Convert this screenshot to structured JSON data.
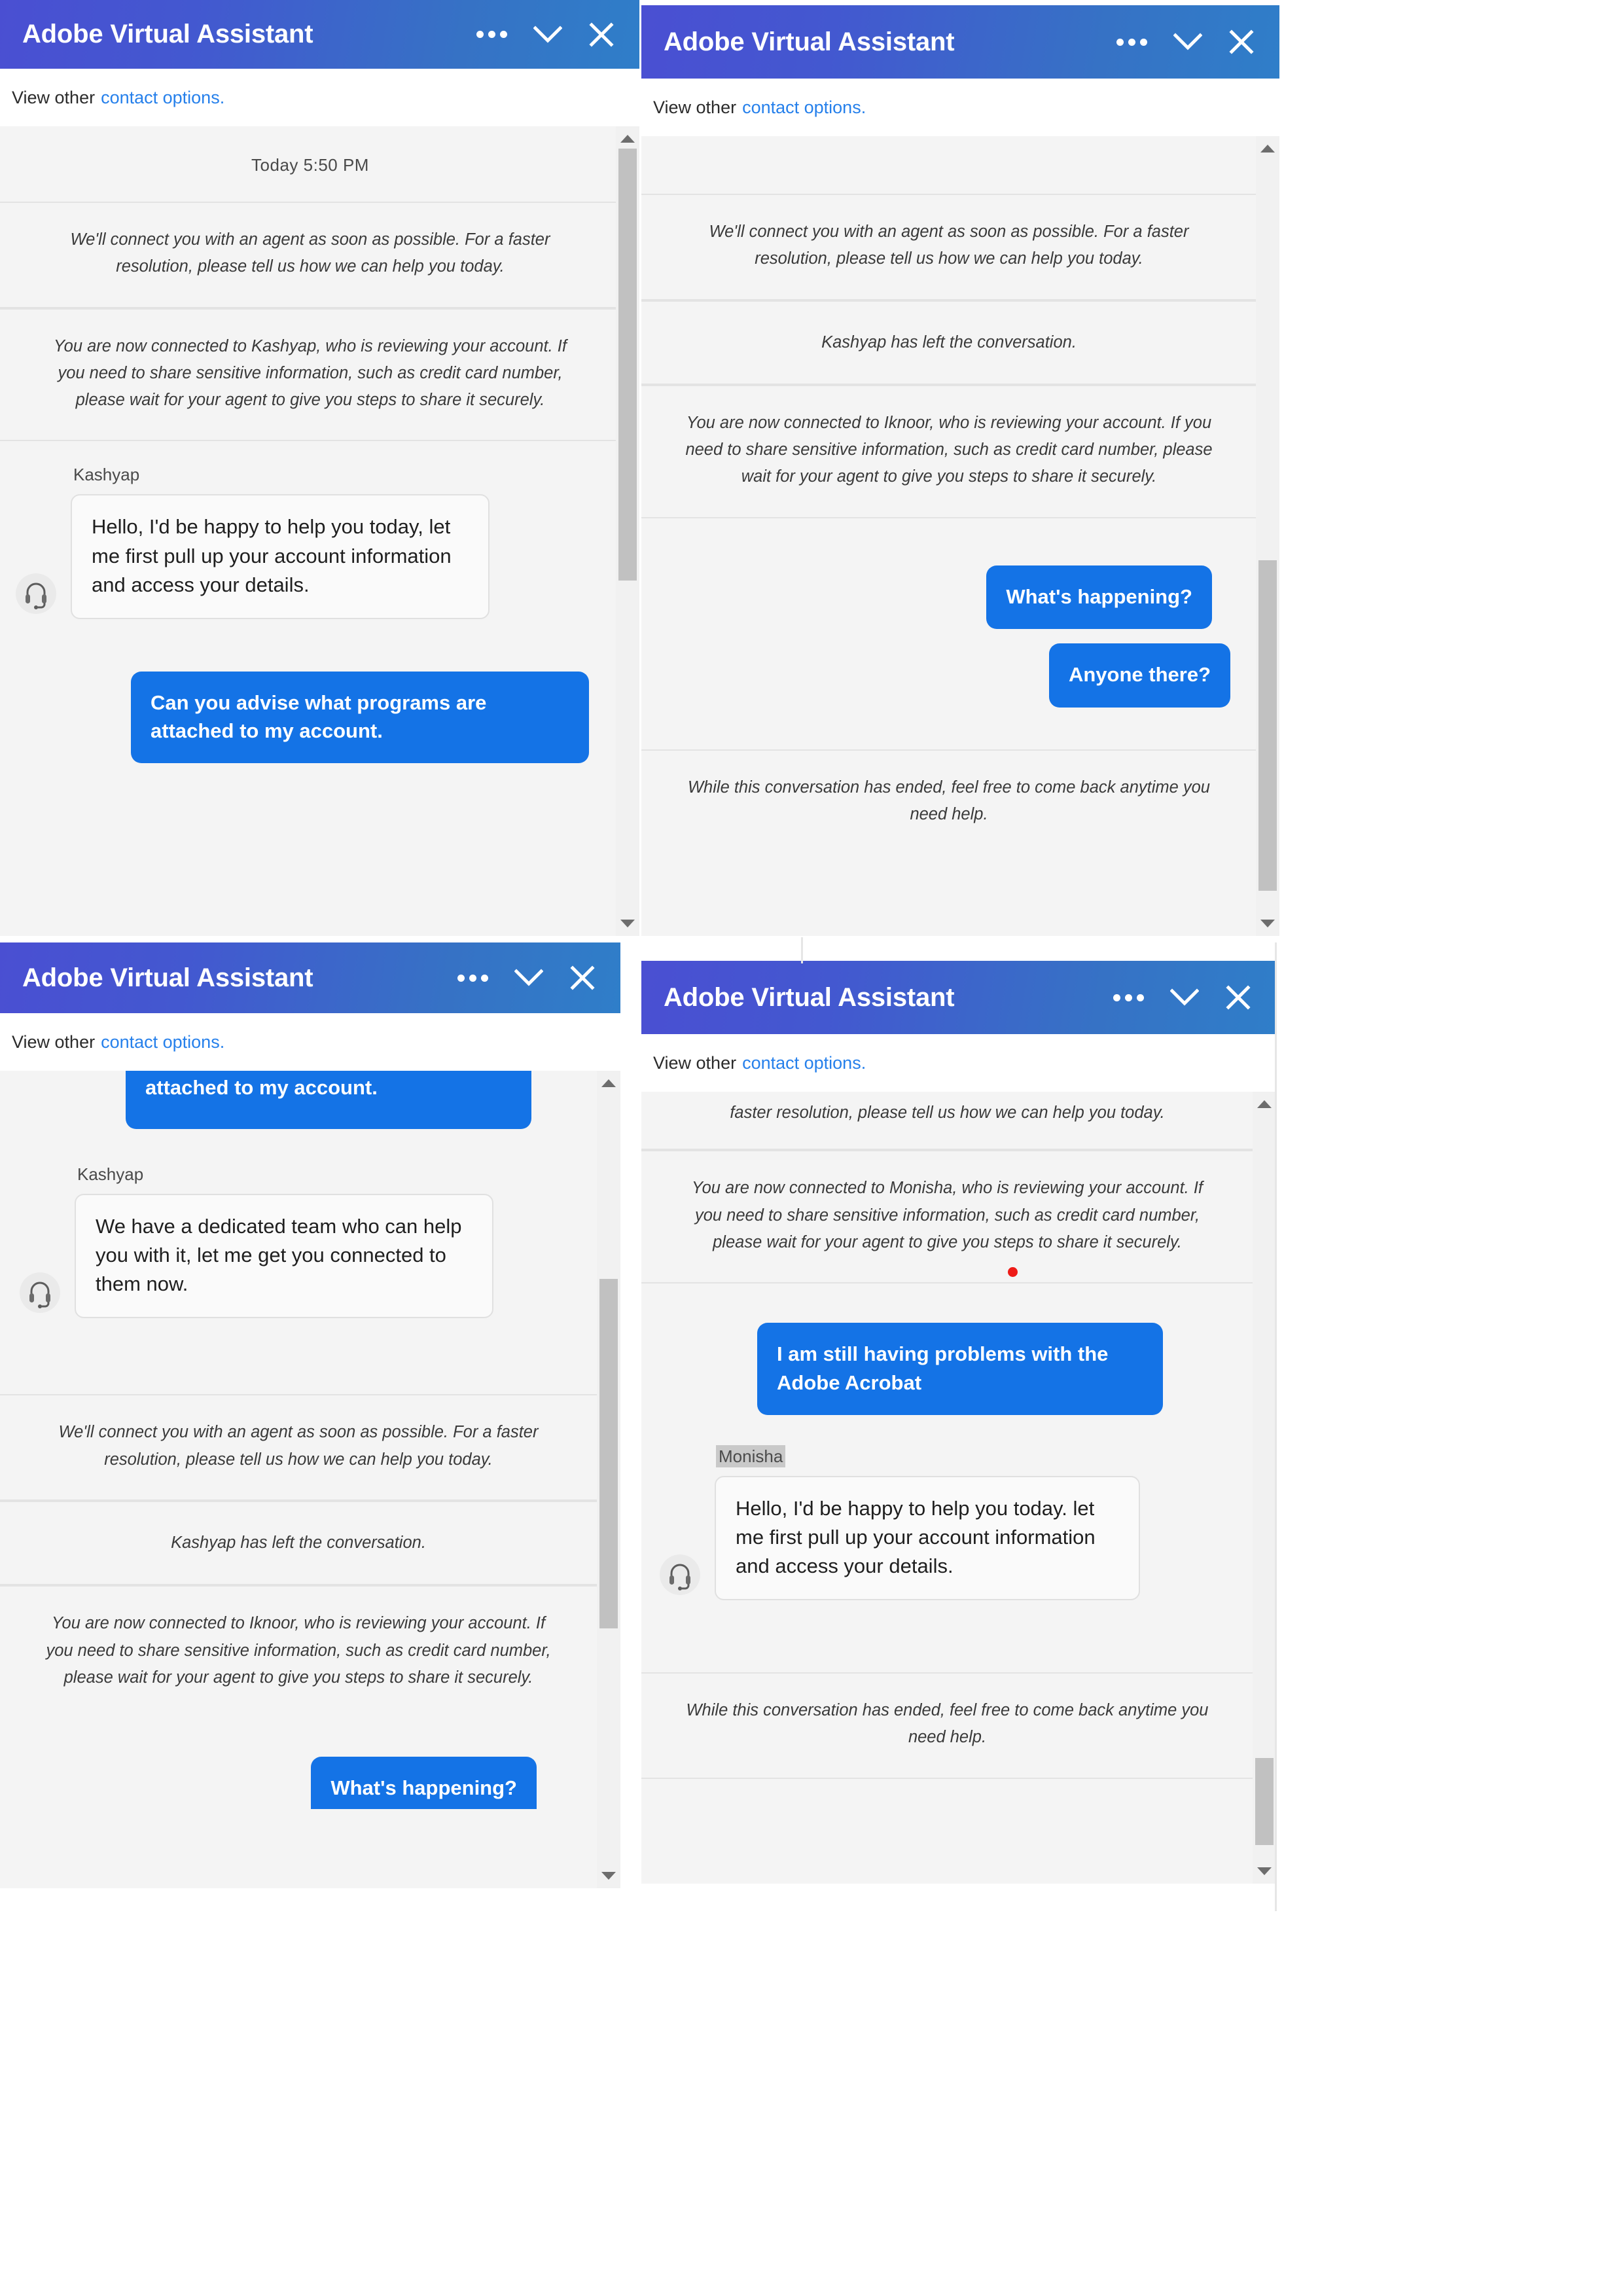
{
  "window_title": "Adobe Virtual Assistant",
  "subbar": {
    "prefix": "View other",
    "link": "contact options."
  },
  "icons": {
    "more": "more-options-icon",
    "minimize": "chevron-down-icon",
    "close": "close-icon",
    "avatar": "headset-agent-avatar-icon",
    "scroll_up": "scroll-up-arrow-icon",
    "scroll_down": "scroll-down-arrow-icon"
  },
  "colors": {
    "header_gradient_start": "#4a4fd2",
    "header_gradient_end": "#2f7ec9",
    "user_bubble": "#1473e6",
    "link": "#2680eb",
    "transcript_bg": "#f4f4f4",
    "cursor_dot": "#ee1b17"
  },
  "strings": {
    "connect_agent": "We'll connect you with an agent as soon as possible. For a faster resolution, please tell us how we can help you today.",
    "connected_kashyap": "You are now connected to Kashyap, who is reviewing your account. If you need to share sensitive information, such as credit card number, please wait for your agent to give you steps to share it securely.",
    "connected_iknoor": "You are now connected to Iknoor, who is reviewing your account. If you need to share sensitive information, such as credit card number, please wait for your agent to give you steps to share it securely.",
    "connected_monisha": "You are now connected to Monisha, who is reviewing your account. If you need to share sensitive information, such as credit card number, please wait for your agent to give you steps to share it securely.",
    "kashyap_left": "Kashyap has left the conversation.",
    "conversation_ended": "While this conversation has ended, feel free to come back anytime you need help.",
    "faster_resolution_tail": "faster resolution, please tell us how we can help you today.",
    "timestamp": "Today  5:50 PM",
    "agent_kashyap": "Kashyap",
    "agent_monisha": "Monisha",
    "greet": "Hello, I'd be happy to help you today, let me first pull up your account information and access your details.",
    "greet_monisha": "Hello, I'd be happy to help you today. let me first pull up your account information and access your details.",
    "user_programs": "Can you advise what programs are attached to my account.",
    "user_programs_tail": "attached to my account.",
    "agent_dedicated": "We have a dedicated team who can help you with it, let me get you connected to them now.",
    "user_whats_happening": "What's happening?",
    "user_anyone_there": "Anyone there?",
    "user_acrobat": "I am still having problems with the Adobe Acrobat"
  },
  "panels": [
    {
      "id": "panel-top-left",
      "title": "Adobe Virtual Assistant",
      "messages": [
        {
          "kind": "daystamp",
          "text": "Today  5:50 PM"
        },
        {
          "kind": "system",
          "text": "We'll connect you with an agent as soon as possible. For a faster resolution, please tell us how we can help you today."
        },
        {
          "kind": "system",
          "text": "You are now connected to Kashyap, who is reviewing your account. If you need to share sensitive information, such as credit card number, please wait for your agent to give you steps to share it securely."
        },
        {
          "kind": "agent",
          "name": "Kashyap",
          "text": "Hello, I'd be happy to help you today, let me first pull up your account information and access your details."
        },
        {
          "kind": "user",
          "text": "Can you advise what programs are attached to my account."
        }
      ]
    },
    {
      "id": "panel-top-right",
      "title": "Adobe Virtual Assistant",
      "messages": [
        {
          "kind": "system",
          "text": "We'll connect you with an agent as soon as possible. For a faster resolution, please tell us how we can help you today."
        },
        {
          "kind": "system",
          "text": "Kashyap has left the conversation."
        },
        {
          "kind": "system",
          "text": "You are now connected to Iknoor, who is reviewing your account. If you need to share sensitive information, such as credit card number, please wait for your agent to give you steps to share it securely."
        },
        {
          "kind": "user",
          "text": "What's happening?"
        },
        {
          "kind": "user",
          "text": "Anyone there?"
        },
        {
          "kind": "system",
          "text": "While this conversation has ended, feel free to come back anytime you need help."
        }
      ]
    },
    {
      "id": "panel-bottom-left",
      "title": "Adobe Virtual Assistant",
      "messages": [
        {
          "kind": "user-partial",
          "text": "attached to my account."
        },
        {
          "kind": "agent",
          "name": "Kashyap",
          "text": "We have a dedicated team who can help you with it, let me get you connected to them now."
        },
        {
          "kind": "system",
          "text": "We'll connect you with an agent as soon as possible. For a faster resolution, please tell us how we can help you today."
        },
        {
          "kind": "system",
          "text": "Kashyap has left the conversation."
        },
        {
          "kind": "system",
          "text": "You are now connected to Iknoor, who is reviewing your account. If you need to share sensitive information, such as credit card number, please wait for your agent to give you steps to share it securely."
        },
        {
          "kind": "user-partial",
          "text": "What's happening?"
        }
      ]
    },
    {
      "id": "panel-bottom-right",
      "title": "Adobe Virtual Assistant",
      "messages": [
        {
          "kind": "system-partial",
          "text": "faster resolution, please tell us how we can help you today."
        },
        {
          "kind": "system",
          "text": "You are now connected to Monisha, who is reviewing your account. If you need to share sensitive information, such as credit card number, please wait for your agent to give you steps to share it securely."
        },
        {
          "kind": "user",
          "text": "I am still having problems with the Adobe Acrobat"
        },
        {
          "kind": "agent",
          "name": "Monisha",
          "text": "Hello, I'd be happy to help you today. let me first pull up your account information and access your details."
        },
        {
          "kind": "system",
          "text": "While this conversation has ended, feel free to come back anytime you need help."
        }
      ]
    }
  ]
}
